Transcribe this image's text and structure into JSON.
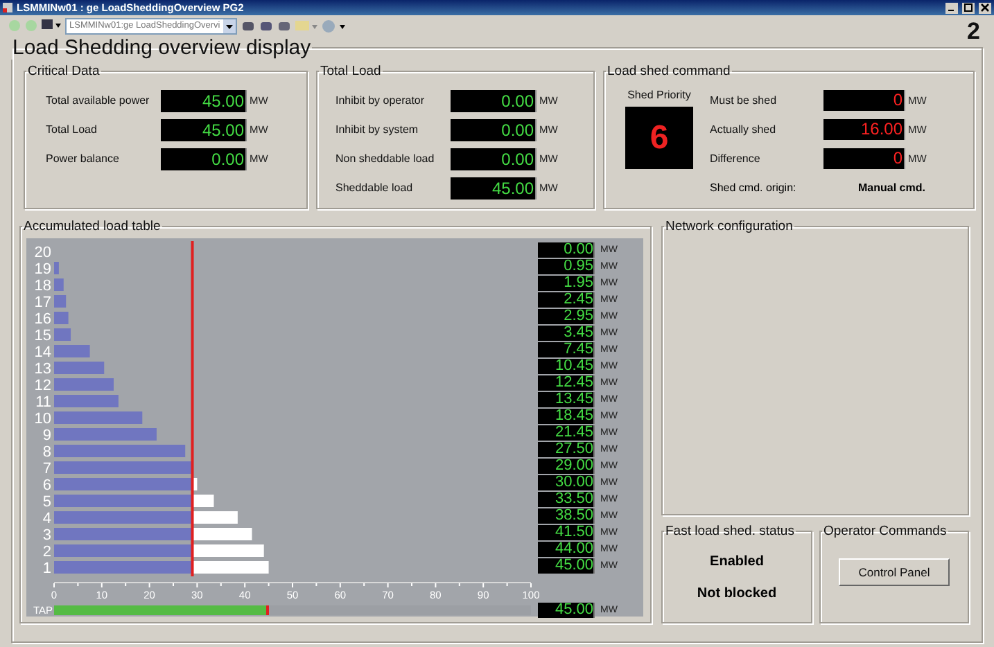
{
  "window": {
    "title": "LSMMINw01 : ge LoadSheddingOverview PG2",
    "page_number": "2"
  },
  "toolbar": {
    "address": "LSMMINw01:ge LoadSheddingOvervi"
  },
  "display": {
    "title": "Load Shedding overview display"
  },
  "critical_data": {
    "title": "Critical Data",
    "rows": [
      {
        "label": "Total available power",
        "value": "45.00",
        "unit": "MW",
        "alarm": false
      },
      {
        "label": "Total Load",
        "value": "45.00",
        "unit": "MW",
        "alarm": false
      },
      {
        "label": "Power balance",
        "value": "0.00",
        "unit": "MW",
        "alarm": false
      }
    ]
  },
  "total_load": {
    "title": "Total Load",
    "rows": [
      {
        "label": "Inhibit by operator",
        "value": "0.00",
        "unit": "MW",
        "alarm": false
      },
      {
        "label": "Inhibit by system",
        "value": "0.00",
        "unit": "MW",
        "alarm": false
      },
      {
        "label": "Non sheddable load",
        "value": "0.00",
        "unit": "MW",
        "alarm": false
      },
      {
        "label": "Sheddable load",
        "value": "45.00",
        "unit": "MW",
        "alarm": false
      }
    ]
  },
  "load_shed_command": {
    "title": "Load shed command",
    "shed_priority": {
      "label": "Shed Priority",
      "value": "6"
    },
    "rows": [
      {
        "label": "Must be shed",
        "value": "0",
        "unit": "MW",
        "alarm": true
      },
      {
        "label": "Actually shed",
        "value": "16.00",
        "unit": "MW",
        "alarm": true
      },
      {
        "label": "Difference",
        "value": "0",
        "unit": "MW",
        "alarm": true
      }
    ],
    "origin": {
      "label": "Shed cmd. origin:",
      "value": "Manual cmd."
    }
  },
  "accumulated_load_table": {
    "title": "Accumulated load table",
    "chart_data": {
      "type": "bar",
      "orientation": "horizontal",
      "stacked": true,
      "categories": [
        "20",
        "19",
        "18",
        "17",
        "16",
        "15",
        "14",
        "13",
        "12",
        "11",
        "10",
        "9",
        "8",
        "7",
        "6",
        "5",
        "4",
        "3",
        "2",
        "1"
      ],
      "series": [
        {
          "color": "#7076c0",
          "values": [
            0,
            1,
            2,
            2.5,
            3,
            3.5,
            7.5,
            10.5,
            12.5,
            13.5,
            18.5,
            21.5,
            27.5,
            29,
            29,
            29,
            29,
            29,
            29,
            29
          ]
        },
        {
          "color": "#ffffff",
          "values": [
            0,
            0,
            0,
            0,
            0,
            0,
            0,
            0,
            0,
            0,
            0,
            0,
            0,
            0,
            1,
            4.5,
            9.5,
            12.5,
            15,
            16
          ]
        }
      ],
      "xlim": [
        0,
        100
      ],
      "xticks": [
        0,
        10,
        20,
        30,
        40,
        50,
        60,
        70,
        80,
        90,
        100
      ],
      "ref_lines": [
        {
          "axis": "x",
          "value": 29,
          "color": "#e02020"
        }
      ]
    },
    "readouts": [
      {
        "value": "0.00",
        "unit": "MW"
      },
      {
        "value": "0.95",
        "unit": "MW"
      },
      {
        "value": "1.95",
        "unit": "MW"
      },
      {
        "value": "2.45",
        "unit": "MW"
      },
      {
        "value": "2.95",
        "unit": "MW"
      },
      {
        "value": "3.45",
        "unit": "MW"
      },
      {
        "value": "7.45",
        "unit": "MW"
      },
      {
        "value": "10.45",
        "unit": "MW"
      },
      {
        "value": "12.45",
        "unit": "MW"
      },
      {
        "value": "13.45",
        "unit": "MW"
      },
      {
        "value": "18.45",
        "unit": "MW"
      },
      {
        "value": "21.45",
        "unit": "MW"
      },
      {
        "value": "27.50",
        "unit": "MW"
      },
      {
        "value": "29.00",
        "unit": "MW"
      },
      {
        "value": "30.00",
        "unit": "MW"
      },
      {
        "value": "33.50",
        "unit": "MW"
      },
      {
        "value": "38.50",
        "unit": "MW"
      },
      {
        "value": "41.50",
        "unit": "MW"
      },
      {
        "value": "44.00",
        "unit": "MW"
      },
      {
        "value": "45.00",
        "unit": "MW"
      }
    ],
    "tap": {
      "label": "TAP",
      "level": 0.45,
      "value": "45.00",
      "unit": "MW"
    }
  },
  "network_configuration": {
    "title": "Network configuration"
  },
  "fast_load_shed_status": {
    "title": "Fast load shed. status",
    "lines": [
      "Enabled",
      "Not blocked"
    ]
  },
  "operator_commands": {
    "title": "Operator Commands",
    "buttons": [
      "Control Panel"
    ]
  }
}
